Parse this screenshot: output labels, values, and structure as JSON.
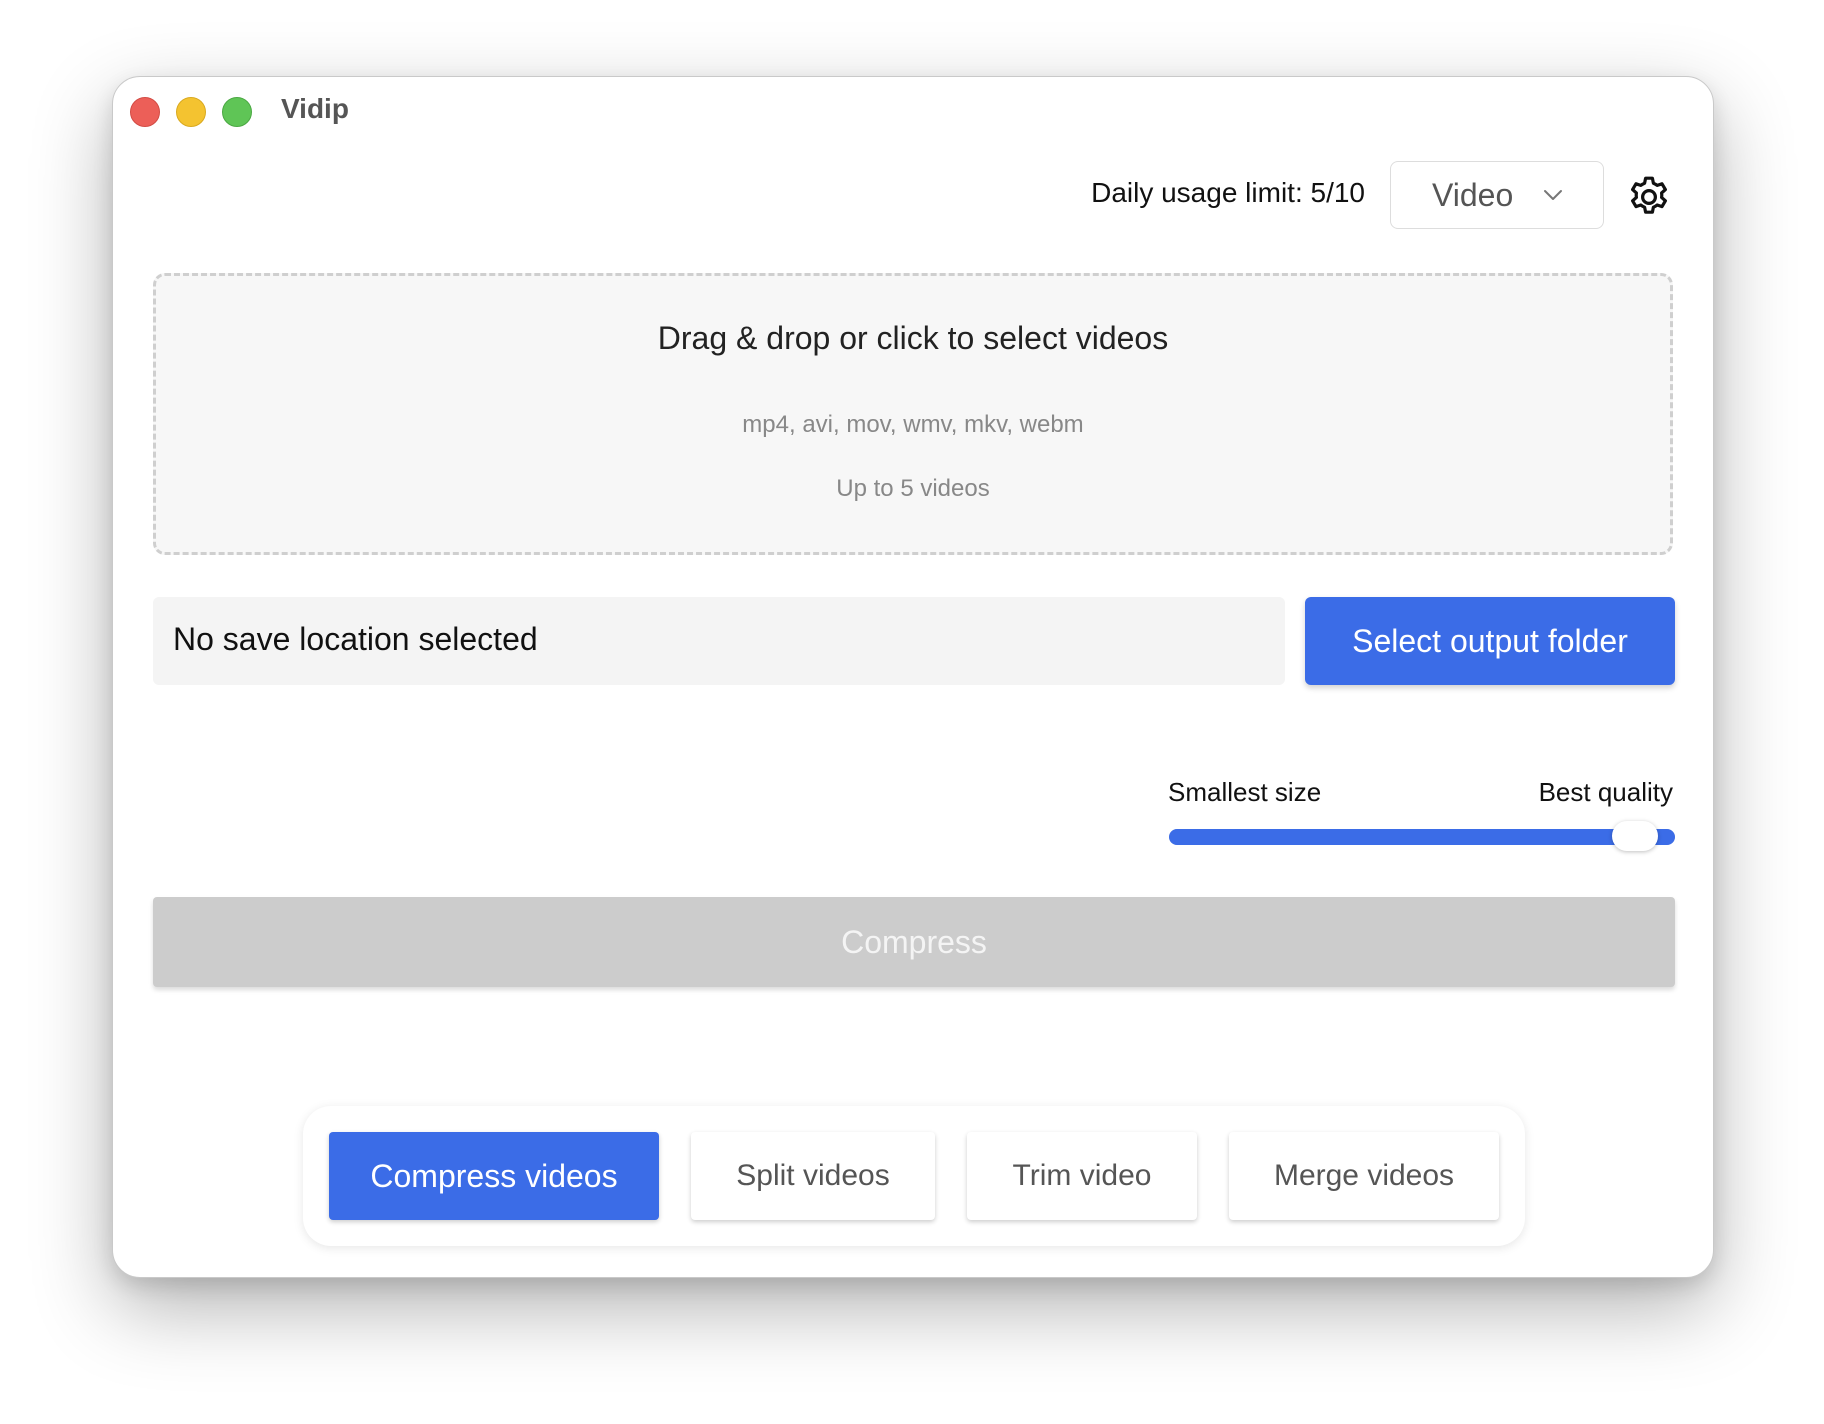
{
  "window": {
    "title": "Vidip"
  },
  "header": {
    "usage_label": "Daily usage limit: 5/10",
    "mode_select": {
      "value": "Video",
      "icon": "chevron-down-icon"
    },
    "settings_icon": "gear-icon"
  },
  "dropzone": {
    "title": "Drag & drop or click to select videos",
    "formats": "mp4, avi, mov, wmv, mkv, webm",
    "limit": "Up to 5 videos"
  },
  "output": {
    "location_text": "No save location selected",
    "select_button": "Select output folder"
  },
  "quality": {
    "min_label": "Smallest size",
    "max_label": "Best quality",
    "value": 0.92
  },
  "compress_button": "Compress",
  "tabs": [
    {
      "label": "Compress videos",
      "active": true
    },
    {
      "label": "Split videos",
      "active": false
    },
    {
      "label": "Trim video",
      "active": false
    },
    {
      "label": "Merge videos",
      "active": false
    }
  ],
  "colors": {
    "accent": "#3b6ce7",
    "disabled": "#cccccc",
    "close": "#ec5f58",
    "minimize": "#f4c330",
    "zoom": "#5fc556"
  }
}
